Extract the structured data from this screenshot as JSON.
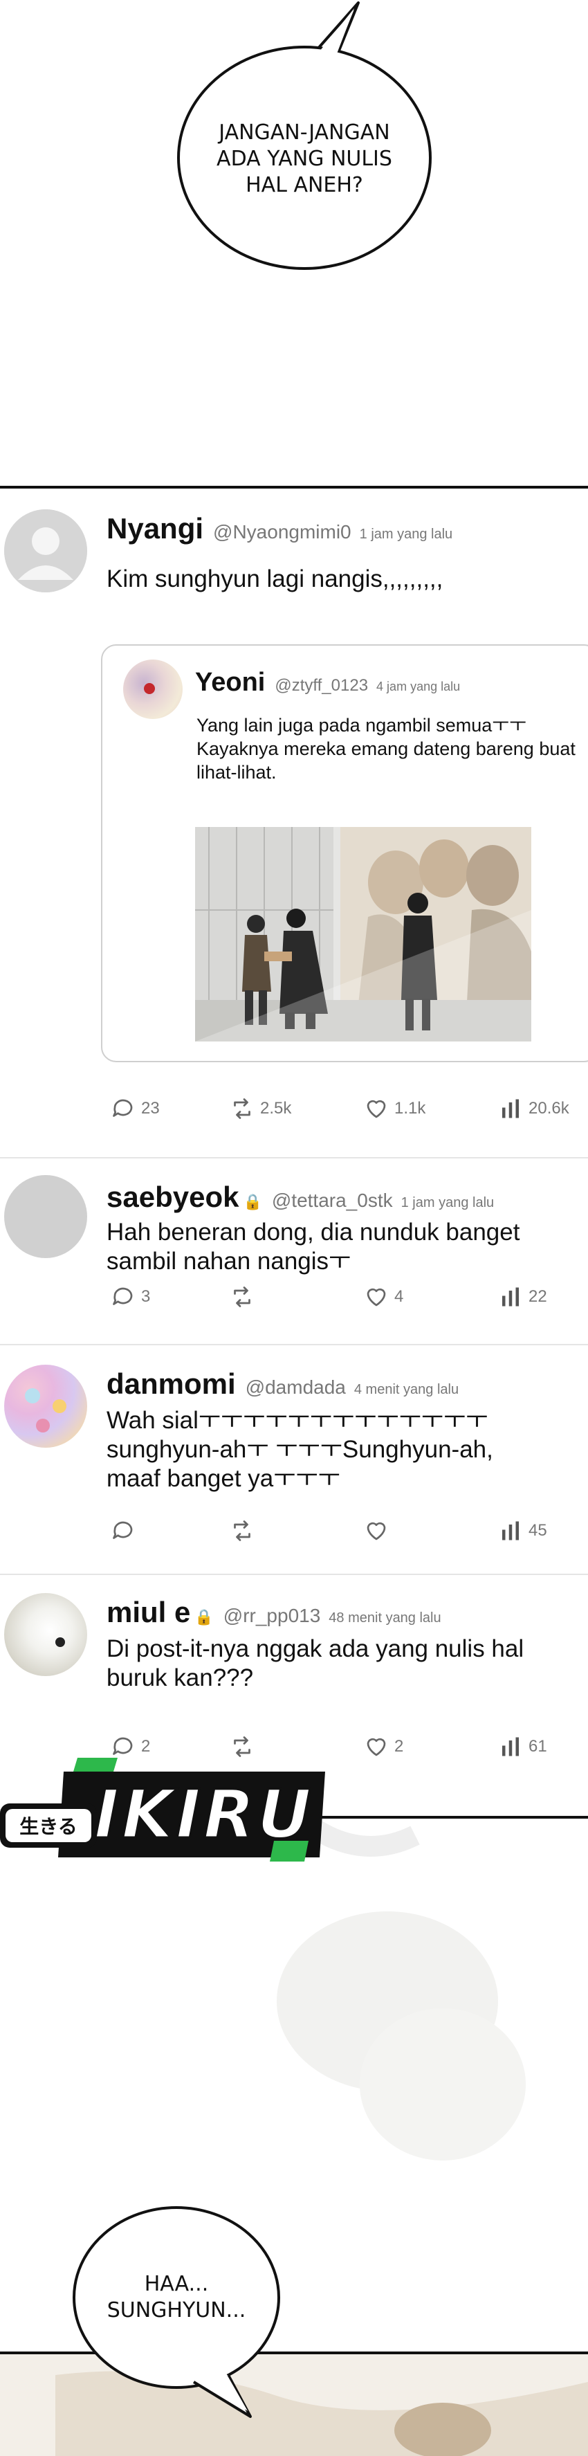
{
  "bubble_top": {
    "text": "JANGAN-JANGAN\nADA YANG NULIS\nHAL ANEH?"
  },
  "bubble_bottom": {
    "text": "HAA...\nSUNGHYUN..."
  },
  "posts": [
    {
      "name": "Nyangi",
      "handle": "@Nyaongmimi0",
      "time": "1 jam yang lalu",
      "text": "Kim sunghyun lagi nangis,,,,,,,,,",
      "quote": {
        "name": "Yeoni",
        "handle": "@ztyff_0123",
        "time": "4 jam yang lalu",
        "text": "Yang lain juga pada ngambil semuaㅜㅜ Kayaknya mereka emang dateng bareng buat lihat-lihat."
      },
      "replies": "23",
      "reposts": "2.5k",
      "likes": "1.1k",
      "views": "20.6k"
    },
    {
      "name": "saebyeok",
      "handle": "@tettara_0stk",
      "time": "1 jam yang lalu",
      "text": "Hah beneran dong, dia nunduk banget sambil nahan nangisㅜ",
      "replies": "3",
      "reposts": "",
      "likes": "4",
      "views": "22"
    },
    {
      "name": "danmomi",
      "handle": "@damdada",
      "time": "4 menit yang lalu",
      "text": "Wah sialㅜㅜㅜㅜㅜㅜㅜㅜㅜㅜㅜㅜㅜ sunghyun-ahㅜ ㅜㅜㅜSunghyun-ah, maaf banget yaㅜㅜㅜ",
      "replies": "",
      "reposts": "",
      "likes": "",
      "views": "45"
    },
    {
      "name": "miul e",
      "handle": "@rr_pp013",
      "time": "48 menit yang lalu",
      "text": "Di post-it-nya nggak ada yang nulis hal buruk kan???",
      "replies": "2",
      "reposts": "",
      "likes": "2",
      "views": "61"
    }
  ],
  "logo": {
    "kana": "生きる",
    "word": "IKIRU"
  },
  "colors": {
    "logo_green": "#2db84b",
    "text": "#111111",
    "muted": "#777777"
  }
}
